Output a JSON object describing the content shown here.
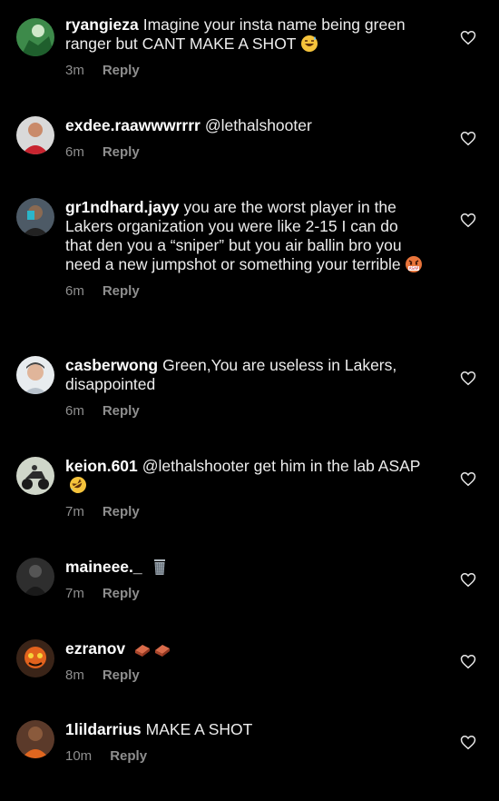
{
  "reply_label": "Reply",
  "comments": [
    {
      "username": "ryangieza",
      "text": "Imagine your insta name being green ranger but CANT MAKE A SHOT",
      "time": "3m",
      "avatar_icon": "green-avatar",
      "emoji": "grinning-sweat-emoji"
    },
    {
      "username": "exdee.raawwwrrrr",
      "text": "@lethalshooter",
      "time": "6m",
      "avatar_icon": "person-red-shirt-avatar",
      "emoji": ""
    },
    {
      "username": "gr1ndhard.jayy",
      "text": "you are the worst player in the Lakers organization you were like 2-15 I can do that den you a “sniper” but you air ballin bro you need a new jumpshot or something your terrible",
      "time": "6m",
      "avatar_icon": "person-avatar",
      "emoji": "angry-asap-emoji"
    },
    {
      "username": "casberwong",
      "text": "Green,You are useless in Lakers, disappointed",
      "time": "6m",
      "avatar_icon": "person-cap-avatar",
      "emoji": ""
    },
    {
      "username": "keion.601",
      "text": "@lethalshooter get him in the lab ASAP",
      "time": "7m",
      "avatar_icon": "atv-avatar",
      "emoji": "rofl-emoji"
    },
    {
      "username": "maineee._",
      "text": "",
      "time": "7m",
      "avatar_icon": "dark-figure-avatar",
      "emoji": "wastebasket-emoji"
    },
    {
      "username": "ezranov",
      "text": "",
      "time": "8m",
      "avatar_icon": "orange-art-avatar",
      "emoji": "brick-emoji"
    },
    {
      "username": "1lildarrius",
      "text": "MAKE A SHOT",
      "time": "10m",
      "avatar_icon": "person-orange-avatar",
      "emoji": ""
    }
  ],
  "colors": {
    "background": "#000000",
    "text": "#ededed",
    "meta": "#8e8e8e"
  }
}
